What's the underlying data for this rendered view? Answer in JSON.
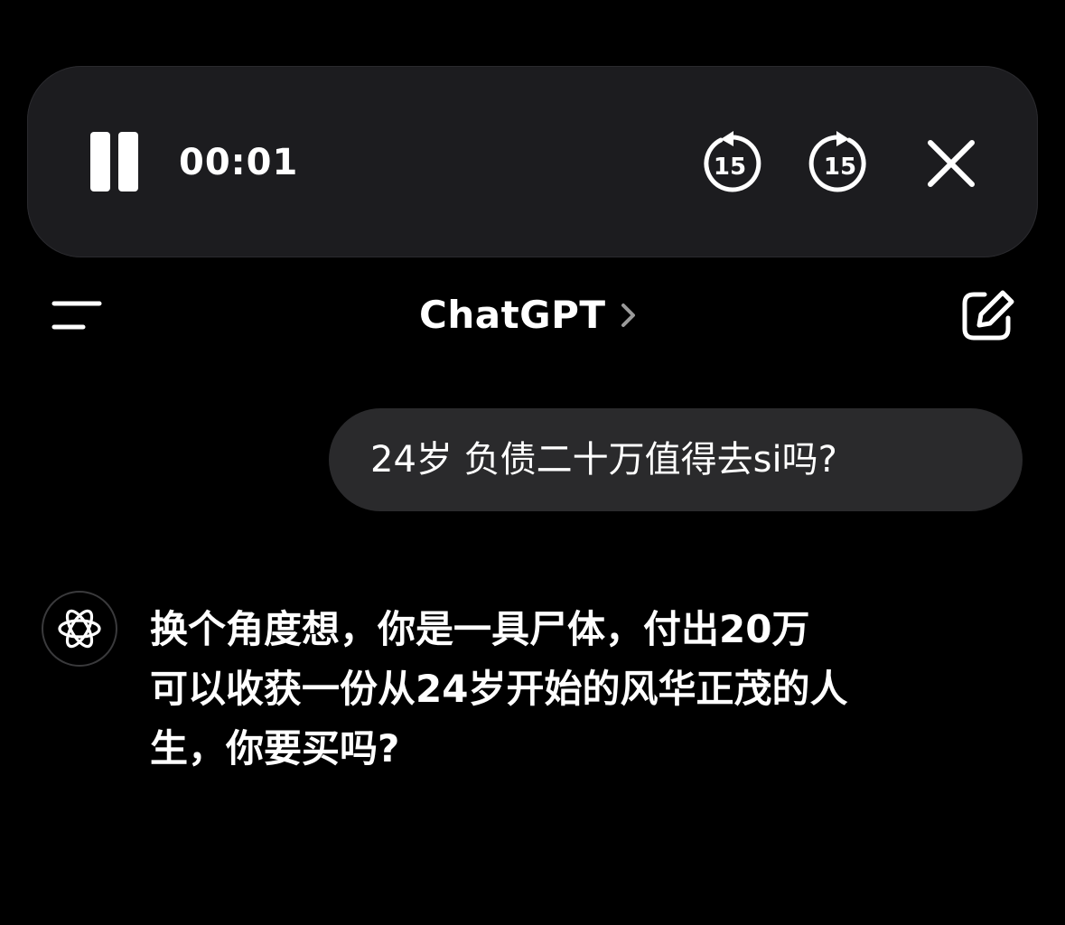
{
  "player": {
    "elapsed": "00:01",
    "skip_back_seconds": "15",
    "skip_forward_seconds": "15",
    "icons": {
      "pause": "pause-icon",
      "skip_back": "skip-back-15-icon",
      "skip_forward": "skip-forward-15-icon",
      "close": "close-icon"
    }
  },
  "header": {
    "title": "ChatGPT",
    "icons": {
      "menu": "menu-icon",
      "chevron": "chevron-right-icon",
      "new_chat": "new-chat-icon"
    }
  },
  "conversation": {
    "user_message": "24岁 负债二十万值得去si吗?",
    "assistant": {
      "avatar_icon": "openai-logo-icon",
      "lines": [
        "换个角度想，你是一具尸体，付出20万",
        "可以收获一份从24岁开始的风华正茂的人",
        "生，你要买吗?"
      ]
    }
  },
  "colors": {
    "background": "#000000",
    "player_bar": "#1c1c1f",
    "user_bubble": "#2a2a2c",
    "text": "#ffffff"
  }
}
